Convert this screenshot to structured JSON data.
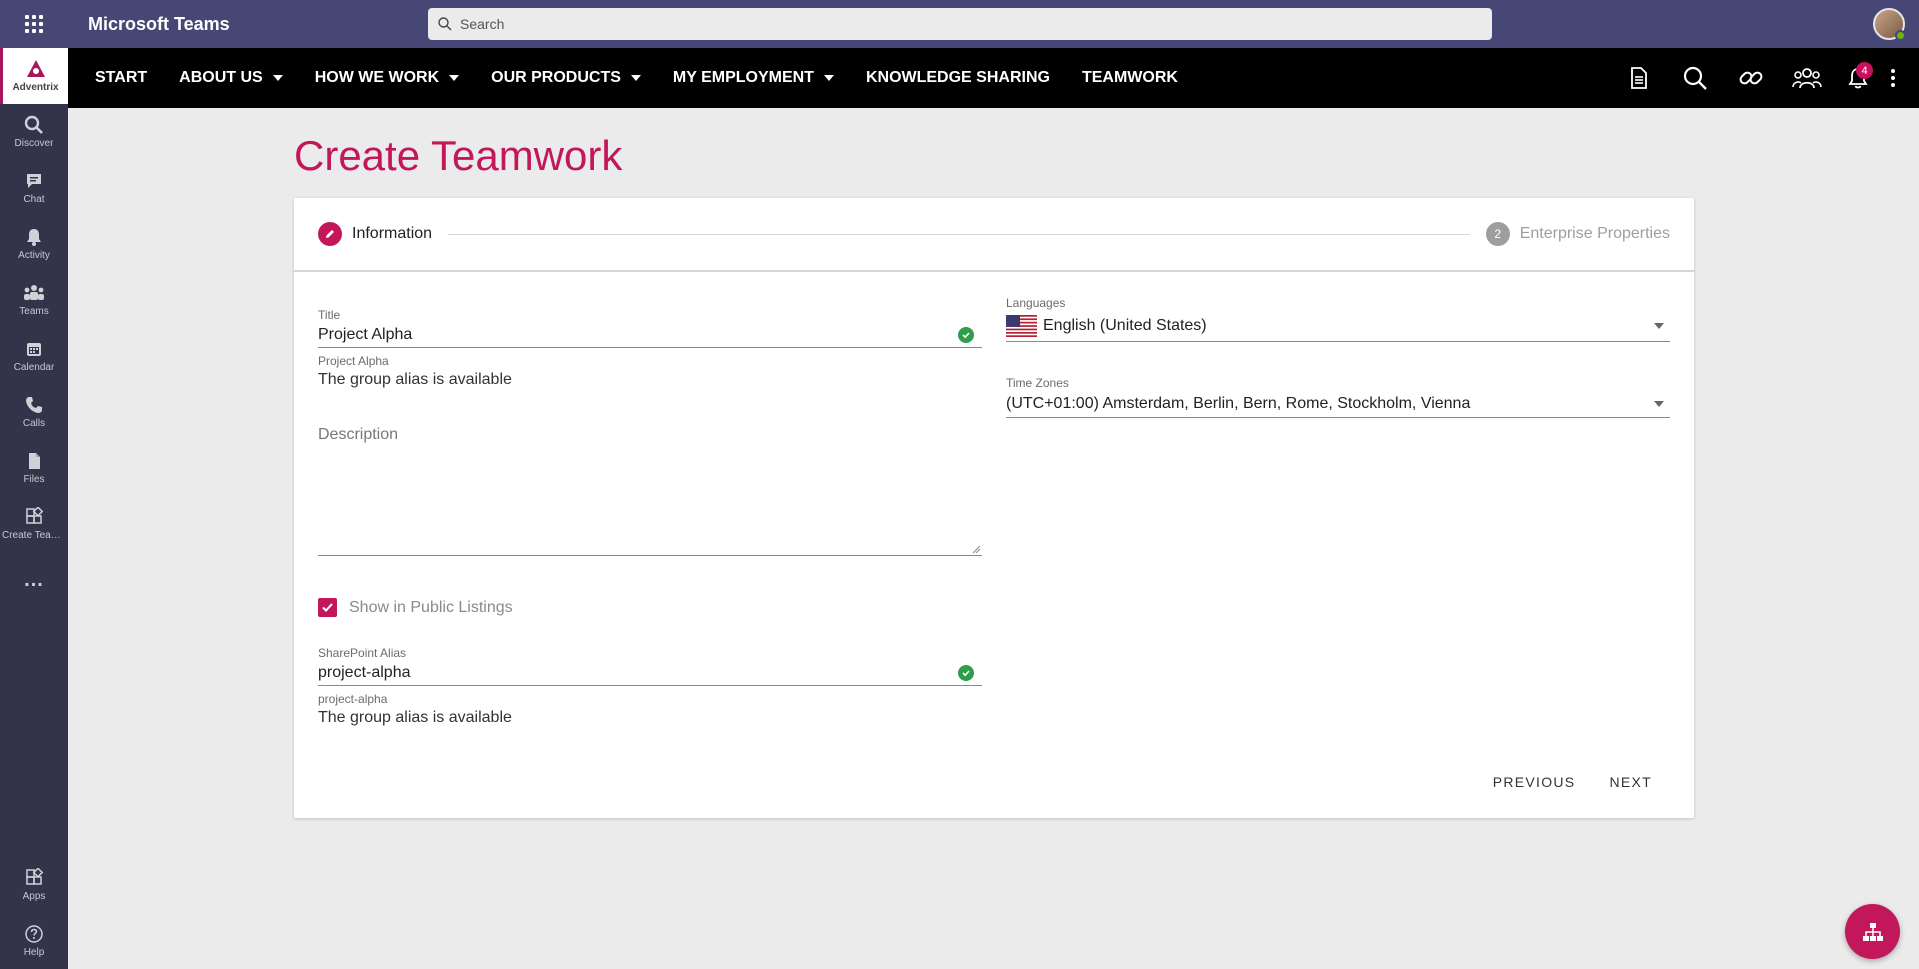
{
  "teams": {
    "app_title": "Microsoft Teams",
    "search_placeholder": "Search",
    "rail": [
      {
        "label": "Adventrix",
        "icon": "adventrix-logo-icon"
      },
      {
        "label": "Discover",
        "icon": "search-icon"
      },
      {
        "label": "Chat",
        "icon": "chat-icon"
      },
      {
        "label": "Activity",
        "icon": "bell-icon"
      },
      {
        "label": "Teams",
        "icon": "teams-icon"
      },
      {
        "label": "Calendar",
        "icon": "calendar-icon"
      },
      {
        "label": "Calls",
        "icon": "phone-icon"
      },
      {
        "label": "Files",
        "icon": "file-icon"
      },
      {
        "label": "Create Teamwork",
        "icon": "apps-icon"
      }
    ],
    "rail_more": "...",
    "rail_bottom": [
      {
        "label": "Apps",
        "icon": "apps-icon"
      },
      {
        "label": "Help",
        "icon": "help-icon"
      }
    ]
  },
  "nav": {
    "links": [
      {
        "label": "START",
        "dropdown": false
      },
      {
        "label": "ABOUT US",
        "dropdown": true
      },
      {
        "label": "HOW WE WORK",
        "dropdown": true
      },
      {
        "label": "OUR PRODUCTS",
        "dropdown": true
      },
      {
        "label": "MY EMPLOYMENT",
        "dropdown": true
      },
      {
        "label": "KNOWLEDGE SHARING",
        "dropdown": false
      },
      {
        "label": "TEAMWORK",
        "dropdown": false
      }
    ],
    "notification_count": "4"
  },
  "page": {
    "title": "Create Teamwork"
  },
  "stepper": {
    "step1_label": "Information",
    "step2_number": "2",
    "step2_label": "Enterprise Properties"
  },
  "form": {
    "title_label": "Title",
    "title_value": "Project Alpha",
    "title_hint_label": "Project Alpha",
    "title_hint_text": "The group alias is available",
    "description_placeholder": "Description",
    "public_listing_label": "Show in Public Listings",
    "public_listing_checked": true,
    "sharepoint_label": "SharePoint Alias",
    "sharepoint_value": "project-alpha",
    "sharepoint_hint_label": "project-alpha",
    "sharepoint_hint_text": "The group alias is available",
    "languages_label": "Languages",
    "languages_value": "English (United States)",
    "timezones_label": "Time Zones",
    "timezones_value": "(UTC+01:00) Amsterdam, Berlin, Bern, Rome, Stockholm, Vienna"
  },
  "actions": {
    "previous": "PREVIOUS",
    "next": "NEXT"
  },
  "colors": {
    "accent": "#c2185b",
    "teams_bar": "#464775",
    "rail": "#33344a",
    "nav_bg": "#000000",
    "success": "#2e9d4c"
  }
}
